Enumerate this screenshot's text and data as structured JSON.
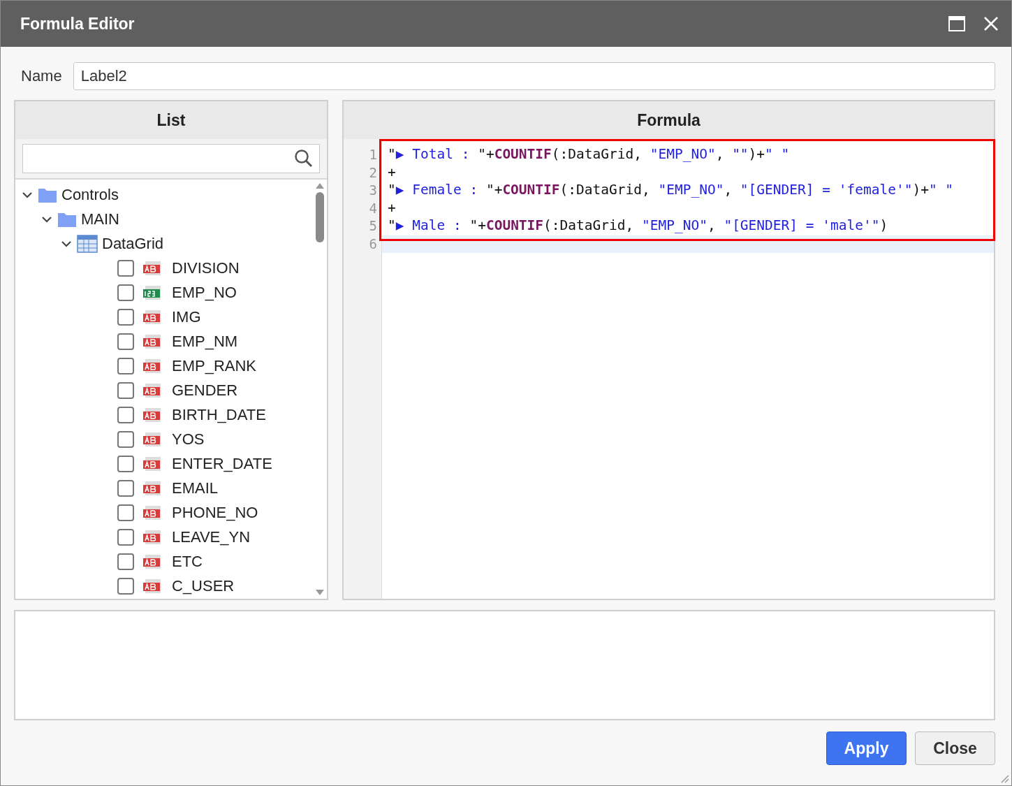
{
  "window": {
    "title": "Formula Editor"
  },
  "name_field": {
    "label": "Name",
    "value": "Label2"
  },
  "list_panel": {
    "header": "List",
    "tree": [
      {
        "label": "Controls",
        "kind": "folder",
        "expanded": true,
        "children": [
          {
            "label": "MAIN",
            "kind": "folder",
            "expanded": true,
            "children": [
              {
                "label": "DataGrid",
                "kind": "grid",
                "expanded": true,
                "children": [
                  {
                    "label": "DIVISION",
                    "kind": "text",
                    "checked": false
                  },
                  {
                    "label": "EMP_NO",
                    "kind": "number",
                    "checked": false
                  },
                  {
                    "label": "IMG",
                    "kind": "text",
                    "checked": false
                  },
                  {
                    "label": "EMP_NM",
                    "kind": "text",
                    "checked": false
                  },
                  {
                    "label": "EMP_RANK",
                    "kind": "text",
                    "checked": false
                  },
                  {
                    "label": "GENDER",
                    "kind": "text",
                    "checked": false
                  },
                  {
                    "label": "BIRTH_DATE",
                    "kind": "text",
                    "checked": false
                  },
                  {
                    "label": "YOS",
                    "kind": "text",
                    "checked": false
                  },
                  {
                    "label": "ENTER_DATE",
                    "kind": "text",
                    "checked": false
                  },
                  {
                    "label": "EMAIL",
                    "kind": "text",
                    "checked": false
                  },
                  {
                    "label": "PHONE_NO",
                    "kind": "text",
                    "checked": false
                  },
                  {
                    "label": "LEAVE_YN",
                    "kind": "text",
                    "checked": false
                  },
                  {
                    "label": "ETC",
                    "kind": "text",
                    "checked": false
                  },
                  {
                    "label": "C_USER",
                    "kind": "text",
                    "checked": false
                  }
                ]
              }
            ]
          }
        ]
      }
    ]
  },
  "formula_panel": {
    "header": "Formula",
    "lines": [
      {
        "number": "1",
        "selected": false,
        "segments": [
          {
            "kind": "plain",
            "text": "\""
          },
          {
            "kind": "string",
            "text": "▶ Total : "
          },
          {
            "kind": "plain",
            "text": "\"+"
          },
          {
            "kind": "function",
            "text": "COUNTIF"
          },
          {
            "kind": "plain",
            "text": "(:DataGrid, "
          },
          {
            "kind": "string",
            "text": "\"EMP_NO\""
          },
          {
            "kind": "plain",
            "text": ", "
          },
          {
            "kind": "string",
            "text": "\"\""
          },
          {
            "kind": "plain",
            "text": ")+"
          },
          {
            "kind": "string",
            "text": "\" \""
          }
        ]
      },
      {
        "number": "2",
        "selected": false,
        "segments": [
          {
            "kind": "plain",
            "text": "+"
          }
        ]
      },
      {
        "number": "3",
        "selected": false,
        "segments": [
          {
            "kind": "plain",
            "text": "\""
          },
          {
            "kind": "string",
            "text": "▶ Female : "
          },
          {
            "kind": "plain",
            "text": "\"+"
          },
          {
            "kind": "function",
            "text": "COUNTIF"
          },
          {
            "kind": "plain",
            "text": "(:DataGrid, "
          },
          {
            "kind": "string",
            "text": "\"EMP_NO\""
          },
          {
            "kind": "plain",
            "text": ", "
          },
          {
            "kind": "string",
            "text": "\"[GENDER] = 'female'\""
          },
          {
            "kind": "plain",
            "text": ")+"
          },
          {
            "kind": "string",
            "text": "\" \""
          }
        ]
      },
      {
        "number": "4",
        "selected": false,
        "segments": [
          {
            "kind": "plain",
            "text": "+"
          }
        ]
      },
      {
        "number": "5",
        "selected": false,
        "segments": [
          {
            "kind": "plain",
            "text": "\""
          },
          {
            "kind": "string",
            "text": "▶ Male : "
          },
          {
            "kind": "plain",
            "text": "\"+"
          },
          {
            "kind": "function",
            "text": "COUNTIF"
          },
          {
            "kind": "plain",
            "text": "(:DataGrid, "
          },
          {
            "kind": "string",
            "text": "\"EMP_NO\""
          },
          {
            "kind": "plain",
            "text": ", "
          },
          {
            "kind": "string",
            "text": "\"[GENDER] = 'male'\""
          },
          {
            "kind": "plain",
            "text": ")"
          }
        ]
      },
      {
        "number": "6",
        "selected": true
      }
    ]
  },
  "buttons": [
    {
      "label": "Apply",
      "kind": "primary"
    },
    {
      "label": "Close",
      "kind": "secondary"
    }
  ]
}
